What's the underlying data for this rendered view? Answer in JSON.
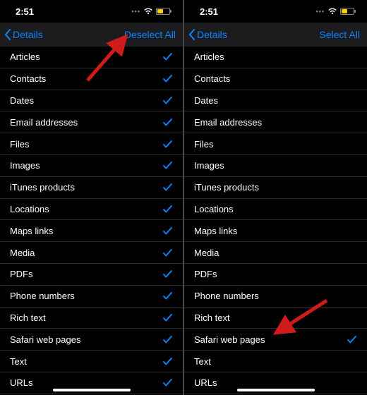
{
  "left": {
    "status": {
      "time": "2:51"
    },
    "nav": {
      "back_label": "Details",
      "action_label": "Deselect All"
    },
    "rows": [
      {
        "label": "Articles",
        "checked": true
      },
      {
        "label": "Contacts",
        "checked": true
      },
      {
        "label": "Dates",
        "checked": true
      },
      {
        "label": "Email addresses",
        "checked": true
      },
      {
        "label": "Files",
        "checked": true
      },
      {
        "label": "Images",
        "checked": true
      },
      {
        "label": "iTunes products",
        "checked": true
      },
      {
        "label": "Locations",
        "checked": true
      },
      {
        "label": "Maps links",
        "checked": true
      },
      {
        "label": "Media",
        "checked": true
      },
      {
        "label": "PDFs",
        "checked": true
      },
      {
        "label": "Phone numbers",
        "checked": true
      },
      {
        "label": "Rich text",
        "checked": true
      },
      {
        "label": "Safari web pages",
        "checked": true
      },
      {
        "label": "Text",
        "checked": true
      },
      {
        "label": "URLs",
        "checked": true
      }
    ]
  },
  "right": {
    "status": {
      "time": "2:51"
    },
    "nav": {
      "back_label": "Details",
      "action_label": "Select All"
    },
    "rows": [
      {
        "label": "Articles",
        "checked": false
      },
      {
        "label": "Contacts",
        "checked": false
      },
      {
        "label": "Dates",
        "checked": false
      },
      {
        "label": "Email addresses",
        "checked": false
      },
      {
        "label": "Files",
        "checked": false
      },
      {
        "label": "Images",
        "checked": false
      },
      {
        "label": "iTunes products",
        "checked": false
      },
      {
        "label": "Locations",
        "checked": false
      },
      {
        "label": "Maps links",
        "checked": false
      },
      {
        "label": "Media",
        "checked": false
      },
      {
        "label": "PDFs",
        "checked": false
      },
      {
        "label": "Phone numbers",
        "checked": false
      },
      {
        "label": "Rich text",
        "checked": false
      },
      {
        "label": "Safari web pages",
        "checked": true
      },
      {
        "label": "Text",
        "checked": false
      },
      {
        "label": "URLs",
        "checked": false
      }
    ]
  },
  "colors": {
    "accent": "#0a84ff",
    "arrow": "#d11a1a"
  }
}
